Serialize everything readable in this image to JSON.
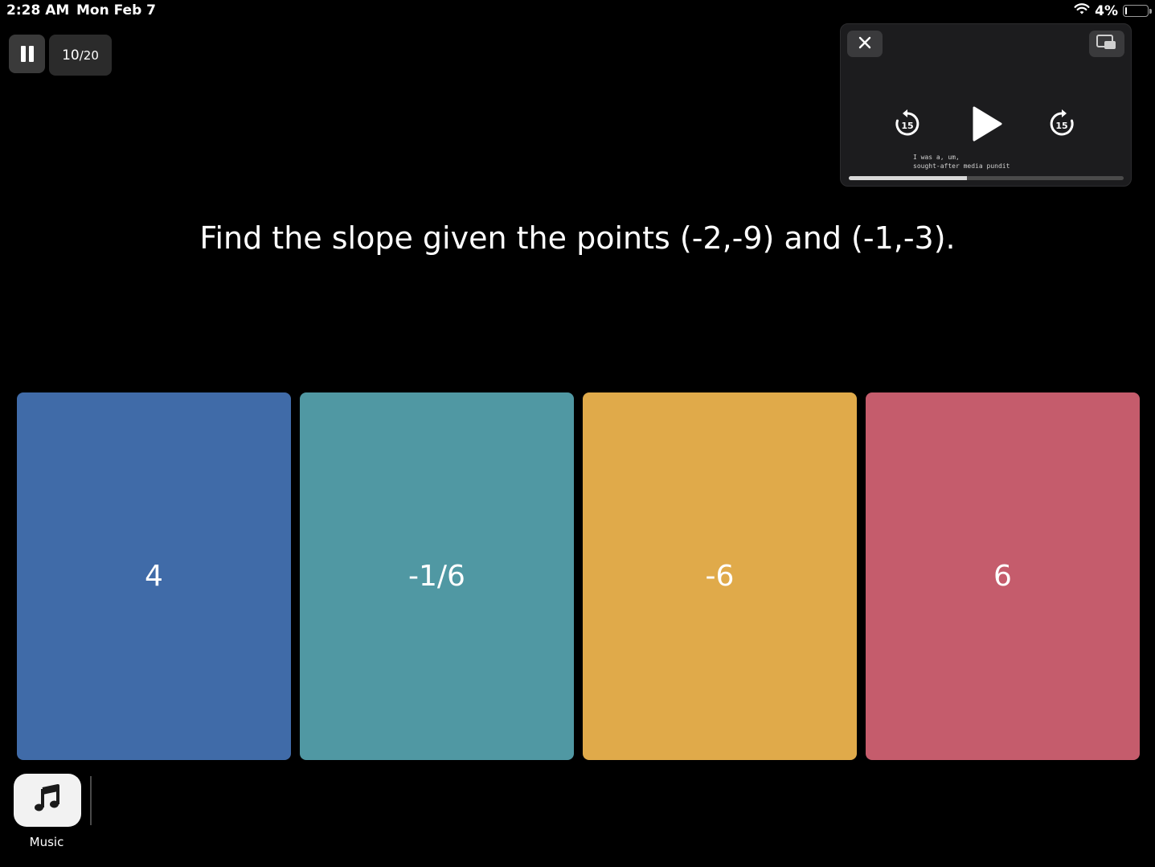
{
  "status_bar": {
    "time": "2:28 AM",
    "date": "Mon Feb 7",
    "battery_percent_label": "4%",
    "battery_level": 0.04,
    "wifi_icon": "wifi-icon",
    "battery_icon": "battery-icon"
  },
  "game": {
    "pause_icon": "pause-icon",
    "progress_current": "10",
    "progress_total": "/20"
  },
  "pip_player": {
    "close_icon": "close-icon",
    "restore_icon": "pip-restore-icon",
    "skip_back_label": "15",
    "skip_forward_label": "15",
    "play_icon": "play-icon",
    "caption_line1": "I was a, um,",
    "caption_line2": "sought-after media pundit",
    "playback_progress": 0.43
  },
  "question": {
    "text": "Find the slope given the points (-2,-9) and (-1,-3)."
  },
  "answers": [
    {
      "label": "4",
      "color": "#406ba8"
    },
    {
      "label": "-1/6",
      "color": "#5098a3"
    },
    {
      "label": "-6",
      "color": "#e0aa4a"
    },
    {
      "label": "6",
      "color": "#c55c6c"
    }
  ],
  "dock": {
    "music_icon": "music-note-icon",
    "music_label": "Music"
  }
}
